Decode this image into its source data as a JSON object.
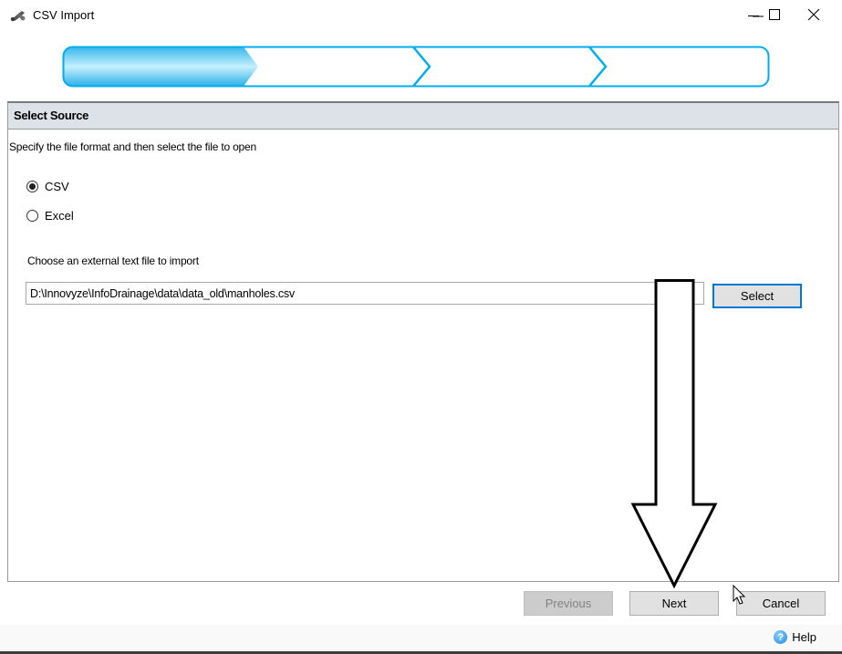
{
  "window": {
    "title": "CSV Import",
    "app_icon": "pipe-tee-icon",
    "controls": {
      "minimize": "minimize-icon",
      "maximize": "maximize-icon",
      "close": "close-icon"
    }
  },
  "wizard": {
    "total_steps": 4,
    "current_step": 1,
    "accent_color": "#00aeef"
  },
  "section": {
    "title": "Select Source",
    "instructions": "Specify the file format and then select the file to open",
    "format_options": [
      {
        "label": "CSV",
        "selected": true
      },
      {
        "label": "Excel",
        "selected": false
      }
    ],
    "file_label": "Choose an external text file to import",
    "file_path": "D:\\Innovyze\\InfoDrainage\\data\\data_old\\manholes.csv",
    "select_button": "Select"
  },
  "footer": {
    "previous": "Previous",
    "next": "Next",
    "cancel": "Cancel",
    "help": "Help",
    "previous_disabled": true
  },
  "annotation": {
    "type": "arrow-down",
    "target": "Next"
  }
}
